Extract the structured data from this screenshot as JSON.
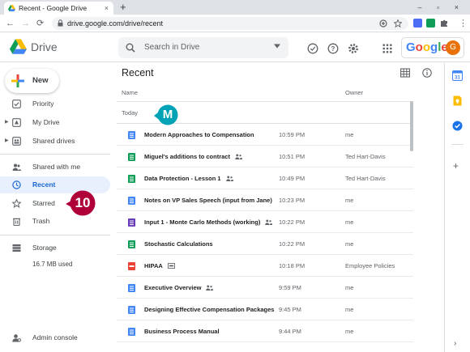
{
  "browser": {
    "tab_title": "Recent - Google Drive",
    "tab_close": "×",
    "new_tab": "+",
    "window_controls": "–  ▫  ×",
    "url": "drive.google.com/drive/recent",
    "back": "←",
    "forward": "→",
    "reload": "⟳",
    "menu_glyph": "⋮"
  },
  "header": {
    "brand": "Drive",
    "search_placeholder": "Search in Drive",
    "google_word": [
      "G",
      "o",
      "o",
      "g",
      "l",
      "e"
    ],
    "google_colors": [
      "#4285f4",
      "#ea4335",
      "#fbbc04",
      "#4285f4",
      "#34a853",
      "#ea4335"
    ],
    "avatar_letter": "G"
  },
  "sidebar": {
    "new_label": "New",
    "items": [
      {
        "label": "Priority",
        "icon": "priority-icon"
      },
      {
        "label": "My Drive",
        "icon": "my-drive-icon"
      },
      {
        "label": "Shared drives",
        "icon": "shared-drives-icon"
      },
      {
        "label": "Shared with me",
        "icon": "shared-with-me-icon"
      },
      {
        "label": "Recent",
        "icon": "clock-icon",
        "active": true
      },
      {
        "label": "Starred",
        "icon": "star-icon"
      },
      {
        "label": "Trash",
        "icon": "trash-icon"
      },
      {
        "label": "Storage",
        "icon": "storage-icon"
      },
      {
        "label": "Admin console",
        "icon": "admin-console-icon"
      }
    ],
    "storage_used": "16.7 MB used"
  },
  "main": {
    "title": "Recent",
    "col_name": "Name",
    "col_owner": "Owner",
    "group_label": "Today",
    "files": [
      {
        "name": "Modern Approaches to Compensation",
        "date": "10:59 PM",
        "owner": "me",
        "type": "doc",
        "shared": false
      },
      {
        "name": "Miguel's additions to contract",
        "date": "10:51 PM",
        "owner": "Ted Hart-Davis",
        "type": "sheet",
        "shared": true
      },
      {
        "name": "Data Protection - Lesson 1",
        "date": "10:49 PM",
        "owner": "Ted Hart-Davis",
        "type": "sheet",
        "shared": true
      },
      {
        "name": "Notes on VP Sales Speech (input from Jane)",
        "date": "10:23 PM",
        "owner": "me",
        "type": "doc",
        "shared": false
      },
      {
        "name": "Input 1 - Monte Carlo Methods (working)",
        "date": "10:22 PM",
        "owner": "me",
        "type": "form",
        "shared": true
      },
      {
        "name": "Stochastic Calculations",
        "date": "10:22 PM",
        "owner": "me",
        "type": "sheet",
        "shared": false
      },
      {
        "name": "HIPAA",
        "date": "10:18 PM",
        "owner": "Employee Policies",
        "type": "pdf",
        "shared": false,
        "shared_drive": true
      },
      {
        "name": "Executive Overview",
        "date": "9:59 PM",
        "owner": "me",
        "type": "doc",
        "shared": true
      },
      {
        "name": "Designing Effective Compensation Packages",
        "date": "9:45 PM",
        "owner": "me",
        "type": "doc",
        "shared": false
      },
      {
        "name": "Business Process Manual",
        "date": "9:44 PM",
        "owner": "me",
        "type": "doc",
        "shared": false
      }
    ]
  },
  "callouts": {
    "m": "M",
    "ten": "10"
  },
  "side_panel": {
    "add": "+",
    "collapse": "›"
  },
  "colors": {
    "accent": "#1a73e8",
    "callout": "#00a2b5",
    "callout10": "#b0003a",
    "doc": "#4285f4",
    "sheet": "#0f9d58",
    "form": "#673ab7",
    "pdf": "#ea4335"
  }
}
